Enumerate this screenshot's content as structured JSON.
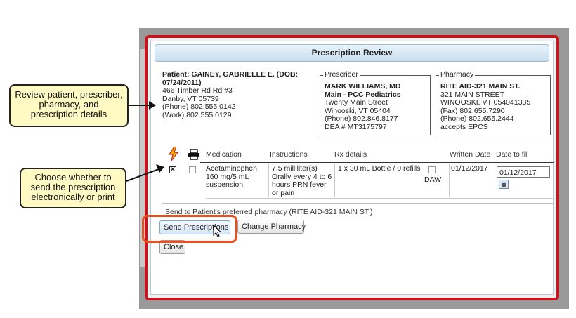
{
  "callouts": {
    "review": "Review patient, prescriber, pharmacy, and prescription details",
    "choose": "Choose whether to send the prescription electronically or print"
  },
  "dialog": {
    "title": "Prescription Review",
    "patient": {
      "name_line": "Patient: GAINEY, GABRIELLE E. (DOB: 07/24/2011)",
      "address1": "466 Timber Rd Rd #3",
      "address2": "Danby, VT 05739",
      "phone": "(Phone) 802.555.0142",
      "work": "(Work) 802.555.0129"
    },
    "prescriber": {
      "legend": "Prescriber",
      "name": "MARK WILLIAMS, MD",
      "practice": "Main - PCC Pediatrics",
      "street": "Twenty Main Street",
      "city": "Winooski, VT 05404",
      "phone": "(Phone) 802.846.8177",
      "dea": "DEA # MT3175797"
    },
    "pharmacy": {
      "legend": "Pharmacy",
      "name": "RITE AID-321 MAIN ST.",
      "street": "321 MAIN STREET",
      "city": "WINOOSKI, VT 054041335",
      "fax": "(Fax) 802.655.7290",
      "phone": "(Phone) 802.655.2444",
      "epcs": "accepts EPCS"
    },
    "table": {
      "headers": {
        "medication": "Medication",
        "instructions": "Instructions",
        "rx_details": "Rx details",
        "written_date": "Written Date",
        "date_to_fill": "Date to fill"
      },
      "row": {
        "medication": "Acetaminophen 160 mg/5 mL suspension",
        "instructions": "7.5 milliliter(s) Orally every 4 to 6 hours PRN fever or pain",
        "rx_details": "1 x 30 mL Bottle / 0 refills",
        "daw": "DAW",
        "written_date": "01/12/2017",
        "date_to_fill": "01/12/2017"
      }
    },
    "send_note": "Send to Patient's preferred pharmacy (RITE AID-321 MAIN ST.)",
    "buttons": {
      "send": "Send Prescriptions",
      "change": "Change Pharmacy",
      "close": "Close"
    }
  },
  "colors": {
    "frame": "#c4161c",
    "highlight": "#e8501f",
    "callout_bg": "#fff9c4"
  },
  "icons": {
    "erx": "lightning-icon",
    "print": "printer-icon",
    "calendar": "calendar-icon",
    "cursor": "mouse-cursor-icon"
  }
}
